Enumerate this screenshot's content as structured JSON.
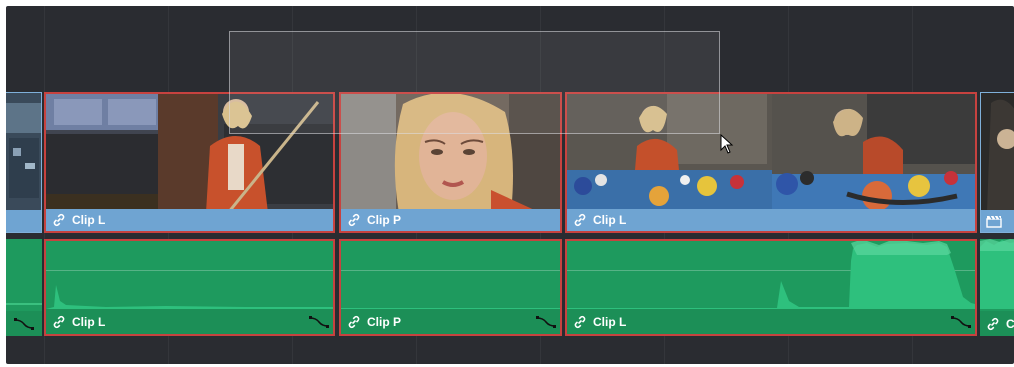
{
  "timeline": {
    "video_track": {
      "clips": [
        {
          "id": "v-edge-left",
          "name": "",
          "selected": false
        },
        {
          "id": "v1",
          "name": "Clip L",
          "selected": true
        },
        {
          "id": "v2",
          "name": "Clip P",
          "selected": true
        },
        {
          "id": "v3",
          "name": "Clip L",
          "selected": true
        },
        {
          "id": "v-edge-right",
          "name": "",
          "selected": false
        }
      ]
    },
    "audio_track": {
      "clips": [
        {
          "id": "a-edge-left",
          "name": "",
          "selected": false
        },
        {
          "id": "a1",
          "name": "Clip L",
          "selected": true
        },
        {
          "id": "a2",
          "name": "Clip P",
          "selected": true
        },
        {
          "id": "a3",
          "name": "Clip L",
          "selected": true
        },
        {
          "id": "a-edge-right",
          "name": "C",
          "selected": false
        }
      ]
    }
  },
  "colors": {
    "timeline_bg": "#2a2c31",
    "video_bar": "#6fa4d2",
    "audio_body": "#1e9a5e",
    "selection_border": "#c7423f"
  },
  "icons": [
    "link-icon",
    "fade-curve-icon",
    "clapperboard-icon",
    "arrow-cursor-icon"
  ]
}
